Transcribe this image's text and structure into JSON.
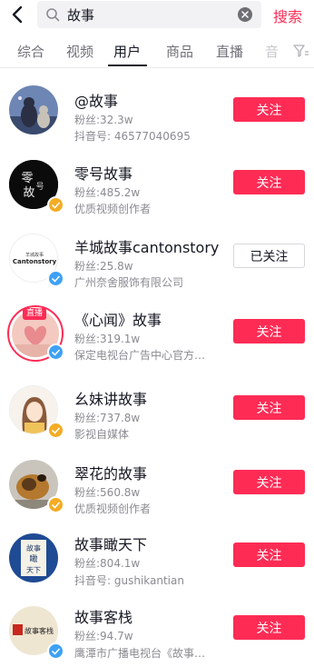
{
  "search": {
    "query": "故事",
    "action_label": "搜索"
  },
  "tabs": [
    {
      "label": "综合",
      "active": false
    },
    {
      "label": "视频",
      "active": false
    },
    {
      "label": "用户",
      "active": true
    },
    {
      "label": "商品",
      "active": false
    },
    {
      "label": "直播",
      "active": false
    },
    {
      "label": "音",
      "active": false
    }
  ],
  "colors": {
    "accent": "#fe2c55",
    "verified_blue": "#3ea1f5",
    "verified_orange": "#f3ac24"
  },
  "users": [
    {
      "name": "@故事",
      "fans": "粉丝:32.3w",
      "desc": "抖音号: 46577040695",
      "follow_label": "关注",
      "followed": false,
      "verified": "none",
      "live": false
    },
    {
      "name": "零号故事",
      "fans": "粉丝:485.2w",
      "desc": "优质视频创作者",
      "follow_label": "关注",
      "followed": false,
      "verified": "orange",
      "live": false,
      "avatar_text": [
        "零",
        "故",
        "号"
      ]
    },
    {
      "name": "羊城故事cantonstory",
      "fans": "粉丝:25.8w",
      "desc": "广州奈舍服饰有限公司",
      "follow_label": "已关注",
      "followed": true,
      "verified": "blue",
      "live": false,
      "avatar_text": [
        "羊城故事",
        "Cantonstory"
      ]
    },
    {
      "name": "《心闻》故事",
      "fans": "粉丝:319.1w",
      "desc": "保定电视台广告中心官方…",
      "follow_label": "关注",
      "followed": false,
      "verified": "blue",
      "live": true,
      "live_label": "直播"
    },
    {
      "name": "幺妹讲故事",
      "fans": "粉丝:737.8w",
      "desc": "影视自媒体",
      "follow_label": "关注",
      "followed": false,
      "verified": "orange",
      "live": false
    },
    {
      "name": "翠花的故事",
      "fans": "粉丝:560.8w",
      "desc": "优质视频创作者",
      "follow_label": "关注",
      "followed": false,
      "verified": "orange",
      "live": false
    },
    {
      "name": "故事瞰天下",
      "fans": "粉丝:804.1w",
      "desc": "抖音号: gushikantian",
      "follow_label": "关注",
      "followed": false,
      "verified": "none",
      "live": false,
      "avatar_text": [
        "故事",
        "瞰",
        "天下"
      ]
    },
    {
      "name": "故事客栈",
      "fans": "粉丝:94.7w",
      "desc": "鹰潭市广播电视台《故事…",
      "follow_label": "关注",
      "followed": false,
      "verified": "blue",
      "live": false,
      "avatar_text": [
        "故事客栈"
      ]
    }
  ]
}
